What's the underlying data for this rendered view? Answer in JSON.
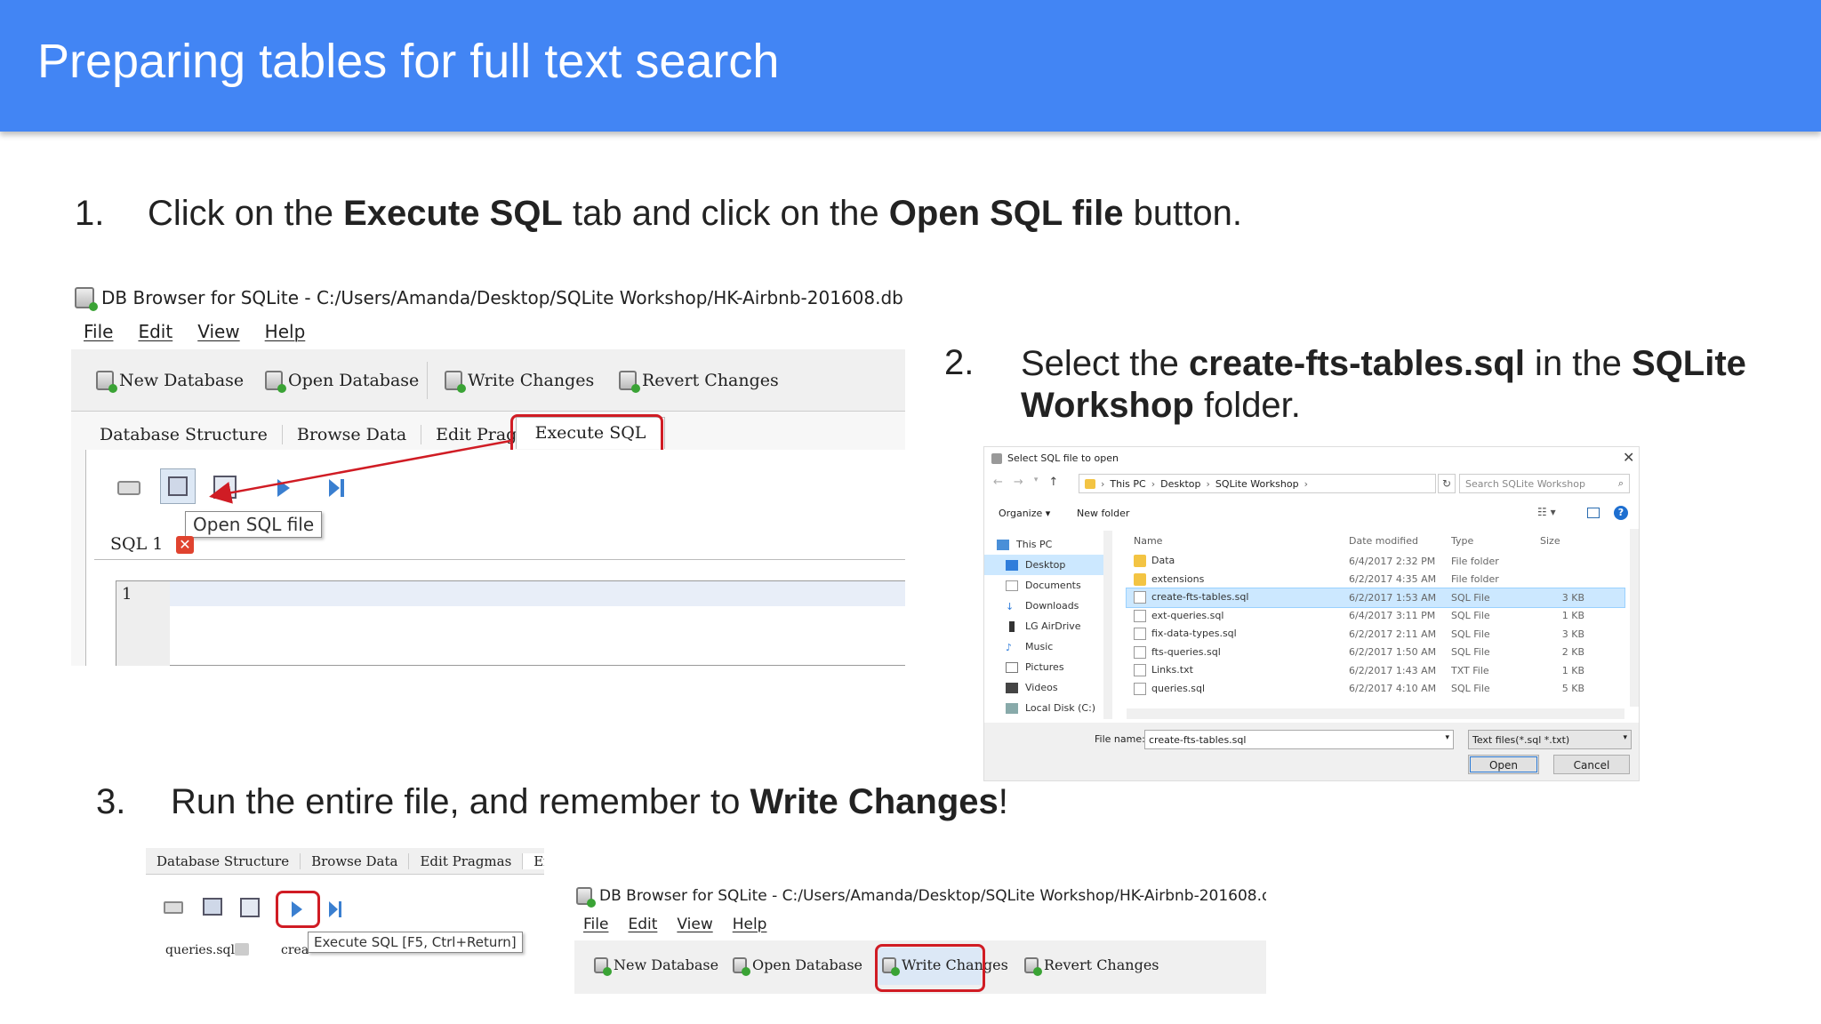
{
  "slide": {
    "title": "Preparing tables for full text search",
    "step1": {
      "num": "1.",
      "t1": "Click on the ",
      "b1": "Execute SQL",
      "t2": " tab and click on the ",
      "b2": "Open SQL file",
      "t3": " button."
    },
    "step2": {
      "num": "2.",
      "t1": "Select the ",
      "b1": "create-fts-tables.sql",
      "t2": " in the ",
      "b2": "SQLite",
      "b3": "Workshop",
      "t3": " folder."
    },
    "step3": {
      "num": "3.",
      "t1": "Run the entire file, and remember to ",
      "b1": "Write Changes",
      "t2": "!"
    }
  },
  "app": {
    "window_title": "DB Browser for SQLite - C:/Users/Amanda/Desktop/SQLite Workshop/HK-Airbnb-201608.db",
    "menu": [
      "File",
      "Edit",
      "View",
      "Help"
    ],
    "toolbar": {
      "new_db": "New Database",
      "open_db": "Open Database",
      "write": "Write Changes",
      "revert": "Revert Changes"
    },
    "tabs": [
      "Database Structure",
      "Browse Data",
      "Edit Pragmas",
      "Execute SQL"
    ],
    "tooltip_open": "Open SQL file",
    "sql_tab": "SQL 1",
    "editor_line": "1"
  },
  "dialog": {
    "title": "Select SQL file to open",
    "breadcrumb": [
      "This PC",
      "Desktop",
      "SQLite Workshop"
    ],
    "search_placeholder": "Search SQLite Workshop",
    "organize": "Organize",
    "new_folder": "New folder",
    "nav": [
      "This PC",
      "Desktop",
      "Documents",
      "Downloads",
      "LG AirDrive",
      "Music",
      "Pictures",
      "Videos",
      "Local Disk (C:)"
    ],
    "columns": [
      "Name",
      "Date modified",
      "Type",
      "Size"
    ],
    "files": [
      {
        "name": "Data",
        "date": "6/4/2017 2:32 PM",
        "type": "File folder",
        "size": "",
        "kind": "folder"
      },
      {
        "name": "extensions",
        "date": "6/2/2017 4:35 AM",
        "type": "File folder",
        "size": "",
        "kind": "folder"
      },
      {
        "name": "create-fts-tables.sql",
        "date": "6/2/2017 1:53 AM",
        "type": "SQL File",
        "size": "3 KB",
        "kind": "file"
      },
      {
        "name": "ext-queries.sql",
        "date": "6/4/2017 3:11 PM",
        "type": "SQL File",
        "size": "1 KB",
        "kind": "file"
      },
      {
        "name": "fix-data-types.sql",
        "date": "6/2/2017 2:11 AM",
        "type": "SQL File",
        "size": "3 KB",
        "kind": "file"
      },
      {
        "name": "fts-queries.sql",
        "date": "6/2/2017 1:50 AM",
        "type": "SQL File",
        "size": "2 KB",
        "kind": "file"
      },
      {
        "name": "Links.txt",
        "date": "6/2/2017 1:43 AM",
        "type": "TXT File",
        "size": "1 KB",
        "kind": "file"
      },
      {
        "name": "queries.sql",
        "date": "6/2/2017 4:10 AM",
        "type": "SQL File",
        "size": "5 KB",
        "kind": "file"
      }
    ],
    "file_name_label": "File name:",
    "file_name_value": "create-fts-tables.sql",
    "filter": "Text files(*.sql *.txt)",
    "open": "Open",
    "cancel": "Cancel"
  },
  "step3ui": {
    "tabs": [
      "Database Structure",
      "Browse Data",
      "Edit Pragmas",
      "Execute"
    ],
    "tooltip": "Execute SQL [F5, Ctrl+Return]",
    "tab_a": "queries.sql",
    "tab_b": "crea"
  },
  "colors": {
    "header": "#4285f4",
    "highlight": "#d01c24",
    "selected_row": "#cce8ff"
  }
}
